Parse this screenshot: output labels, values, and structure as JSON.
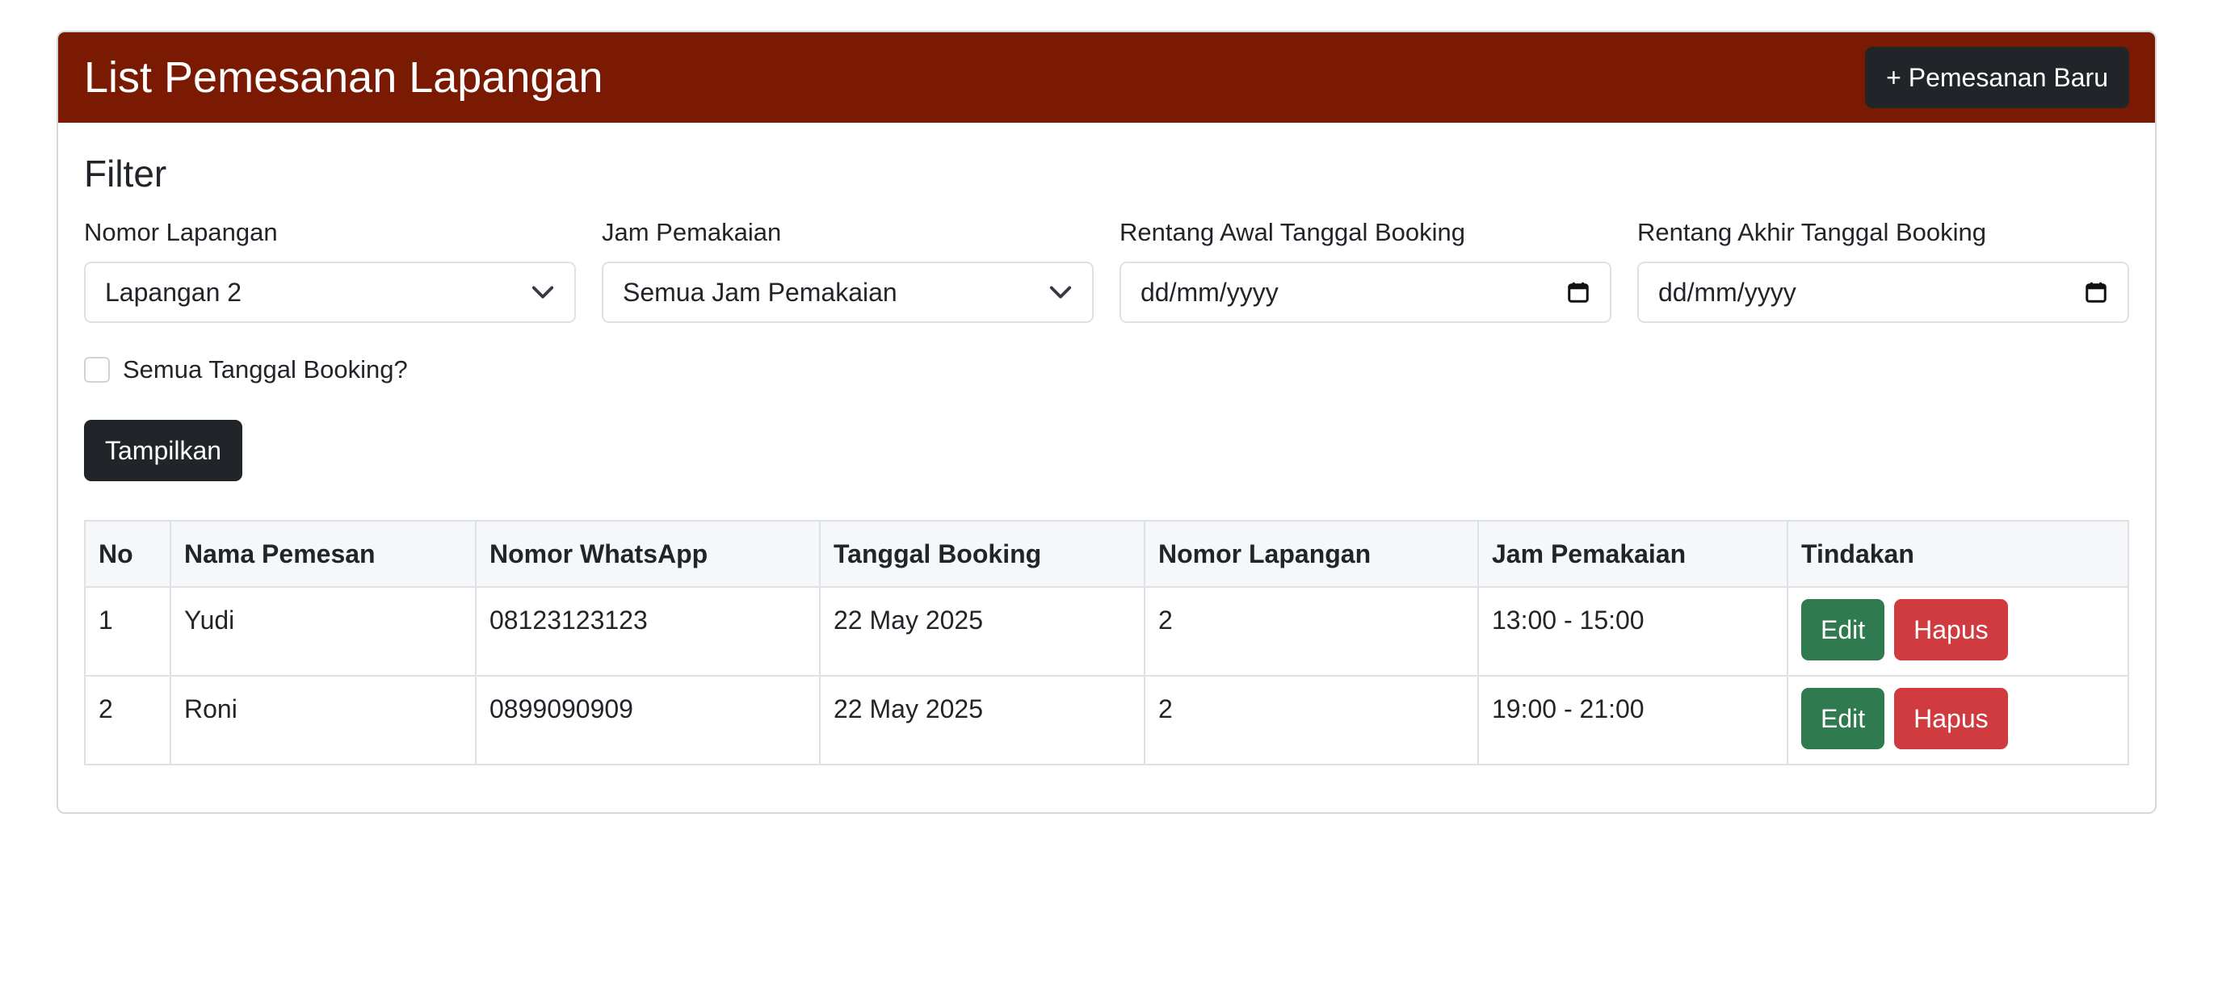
{
  "header": {
    "title": "List Pemesanan Lapangan",
    "new_button": "+ Pemesanan Baru"
  },
  "filter": {
    "title": "Filter",
    "court": {
      "label": "Nomor Lapangan",
      "value": "Lapangan 2"
    },
    "hours": {
      "label": "Jam Pemakaian",
      "value": "Semua Jam Pemakaian"
    },
    "start_date": {
      "label": "Rentang Awal Tanggal Booking",
      "placeholder": "dd/mm/yyyy"
    },
    "end_date": {
      "label": "Rentang Akhir Tanggal Booking",
      "placeholder": "dd/mm/yyyy"
    },
    "all_dates_label": "Semua Tanggal Booking?",
    "all_dates_checked": false,
    "show_button": "Tampilkan"
  },
  "table": {
    "headers": [
      "No",
      "Nama Pemesan",
      "Nomor WhatsApp",
      "Tanggal Booking",
      "Nomor Lapangan",
      "Jam Pemakaian",
      "Tindakan"
    ],
    "rows": [
      {
        "no": "1",
        "name": "Yudi",
        "whatsapp": "08123123123",
        "date": "22 May 2025",
        "court": "2",
        "hours": "13:00 - 15:00"
      },
      {
        "no": "2",
        "name": "Roni",
        "whatsapp": "0899090909",
        "date": "22 May 2025",
        "court": "2",
        "hours": "19:00 - 21:00"
      }
    ],
    "edit_label": "Edit",
    "delete_label": "Hapus"
  },
  "colors": {
    "header_bg": "#7a1a03",
    "dark_button": "#212529",
    "edit_button": "#2f7a4f",
    "delete_button": "#d03b3f"
  },
  "icons": [
    "chevron-down-icon",
    "calendar-icon"
  ]
}
